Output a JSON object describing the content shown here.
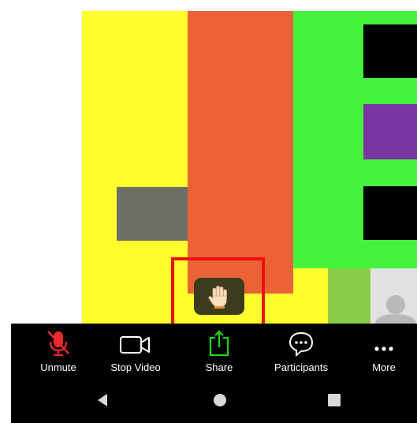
{
  "toolbar": {
    "items": [
      {
        "label": "Unmute",
        "icon": "mic-muted-icon"
      },
      {
        "label": "Stop Video",
        "icon": "video-camera-icon"
      },
      {
        "label": "Share",
        "icon": "share-screen-icon"
      },
      {
        "label": "Participants",
        "icon": "participants-chat-icon"
      },
      {
        "label": "More",
        "icon": "more-dots-icon"
      }
    ]
  },
  "raise_hand": {
    "icon": "raised-hand-icon"
  },
  "navigation": [
    "back-icon",
    "home-icon",
    "recents-icon"
  ],
  "colors": {
    "muted_red": "#ee2a2a",
    "share_green": "#1fd51f",
    "highlight_red": "#ee0f0f",
    "toolbar_bg": "#000000",
    "panel_yellow": "#ffff2e",
    "panel_orange": "#ec6237",
    "panel_green": "#44f43c",
    "panel_purple": "#7a35a3"
  }
}
